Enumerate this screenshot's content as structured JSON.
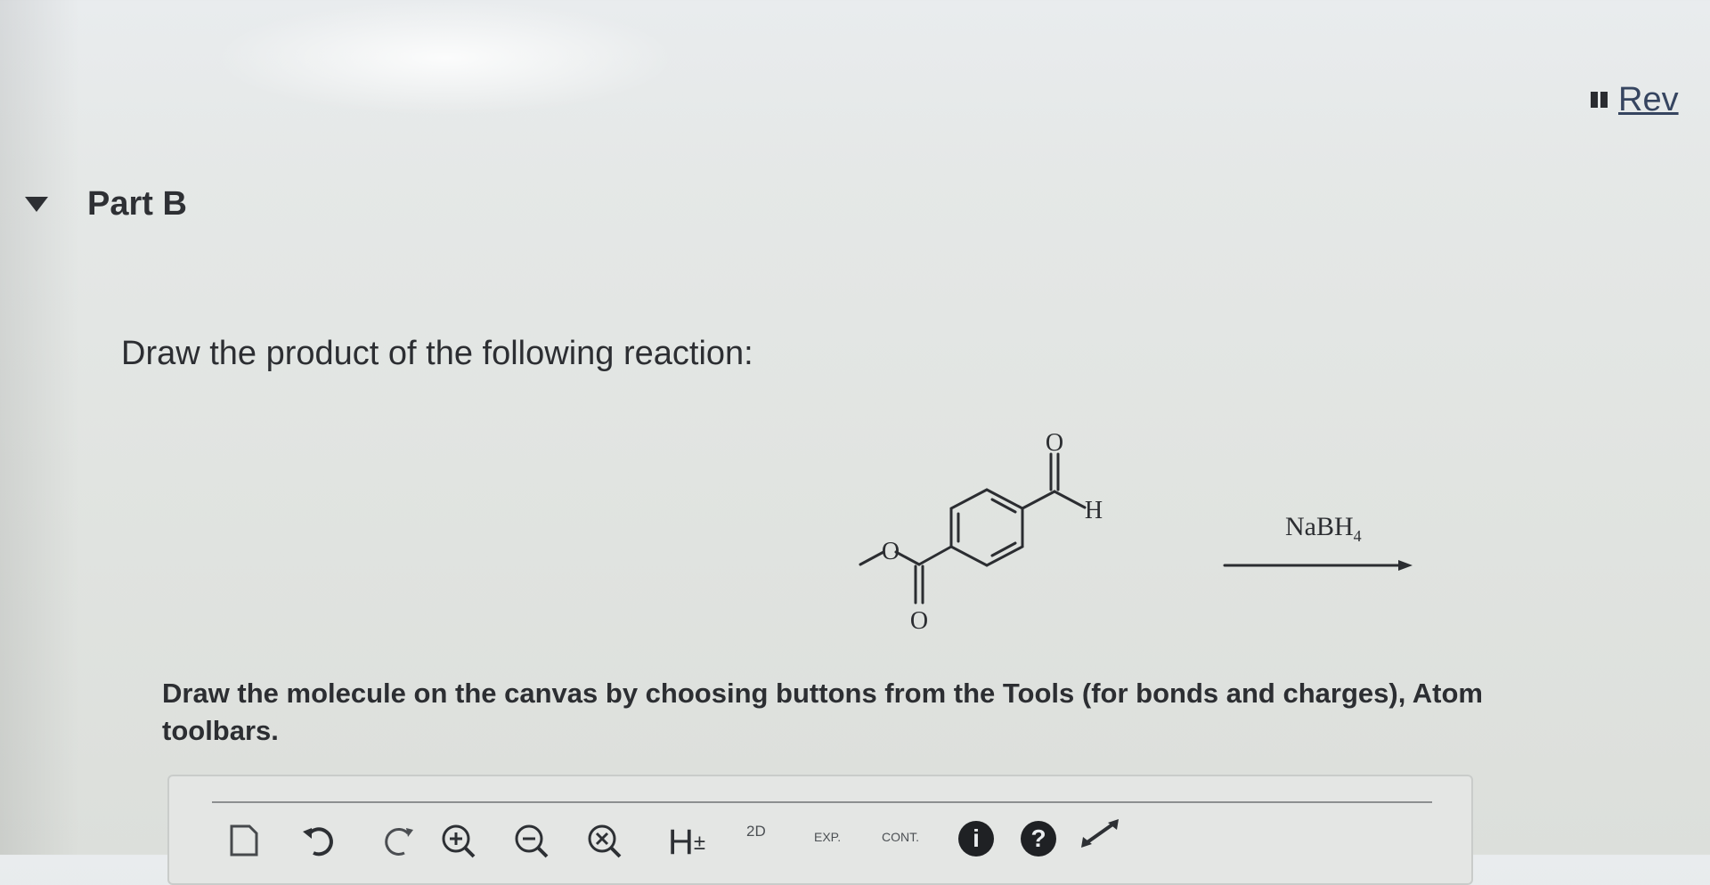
{
  "header": {
    "review_label": "Rev"
  },
  "part": {
    "title": "Part B"
  },
  "question": {
    "prompt": "Draw the product of the following reaction:",
    "reagent_main": "NaBH",
    "reagent_sub": "4",
    "reactant_labels": {
      "aldehyde_O": "O",
      "aldehyde_H": "H",
      "ester_O": "O",
      "carbonyl_O": "O"
    },
    "instructions": "Draw the molecule on the canvas by choosing buttons from the Tools (for bonds and charges), Atom",
    "instructions_cont": "toolbars."
  },
  "toolbar": {
    "h_label": "H",
    "h_sup": "±",
    "twod_label": "2D",
    "exp_label": "EXP.",
    "cont_label": "CONT.",
    "info_label": "i",
    "help_label": "?"
  },
  "icons": {
    "new": "new-document-icon",
    "undo": "undo-icon",
    "redo": "redo-icon",
    "zoom_in": "zoom-in-icon",
    "zoom_out": "zoom-out-icon",
    "clear": "clear-icon",
    "expand": "expand-arrow-icon"
  }
}
